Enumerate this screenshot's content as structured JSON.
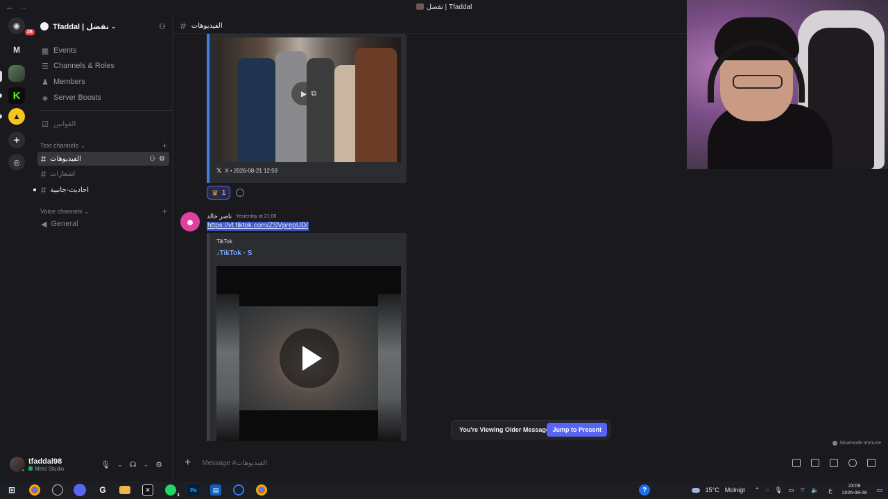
{
  "window": {
    "title": "تفضل | Tfaddal"
  },
  "rail": {
    "badge": "26",
    "letter_server": "M"
  },
  "sidebar": {
    "guild_name": "Tfaddal | تفضل",
    "menu": [
      {
        "label": "Events",
        "icon": "calendar-icon"
      },
      {
        "label": "Channels & Roles",
        "icon": "list-icon"
      },
      {
        "label": "Members",
        "icon": "members-icon"
      },
      {
        "label": "Server Boosts",
        "icon": "boost-icon"
      }
    ],
    "rules_channel": "القوانين",
    "text_category": "Text channels",
    "text_channels": [
      "الفيديوهات",
      "اشعارات",
      "احاديث-جانبية"
    ],
    "voice_category": "Voice channels",
    "voice_channels": [
      "General"
    ]
  },
  "user": {
    "name": "tfaddal98",
    "status": "Meld Studio"
  },
  "header": {
    "channel": "الفيديوهات"
  },
  "message1": {
    "embed_footer": "X • 2026-08-21 12:59",
    "reaction_count": "1"
  },
  "message2": {
    "author": "ناصر خالد",
    "time": "Yesterday at 21:08",
    "link": "https://vt.tiktok.com/ZSVprepUD/",
    "provider": "TikTok",
    "embed_title": "TikTok · S"
  },
  "older_bar": {
    "text": "You're Viewing Older Messages",
    "jump": "Jump to Present"
  },
  "slowmode": "Slowmode Immune",
  "composer": {
    "placeholder": "Message #الفيديوهات"
  },
  "taskbar": {
    "temperature": "15°C",
    "weather": "Molnigt",
    "lang": "ع",
    "time": "23:09",
    "date": "2026-08-28",
    "whatsapp_badge": "1"
  },
  "colors": {
    "accent": "#5865f2",
    "background": "#1a1a1e",
    "embed_bar": "#3b82e0",
    "link_highlight": "#3c57c9",
    "online": "#23a55a"
  }
}
